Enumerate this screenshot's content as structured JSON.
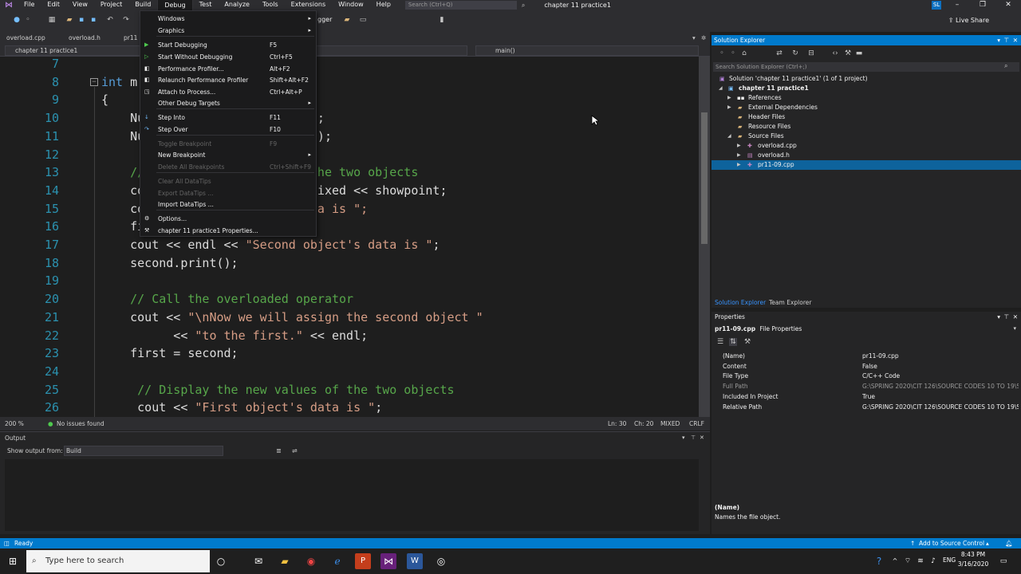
{
  "menubar": {
    "items": [
      "File",
      "Edit",
      "View",
      "Project",
      "Build",
      "Debug",
      "Test",
      "Analyze",
      "Tools",
      "Extensions",
      "Window",
      "Help"
    ],
    "search_placeholder": "Search (Ctrl+Q)",
    "window_title": "chapter 11 practice1",
    "user_initials": "SL"
  },
  "toolbar": {
    "live_share": "Live Share",
    "partial_label": "gger"
  },
  "doc_tabs": [
    "overload.cpp",
    "overload.h",
    "pr11"
  ],
  "nav": {
    "project": "chapter 11 practice1",
    "function": "main()"
  },
  "code_lines": [
    {
      "n": "7",
      "parts": []
    },
    {
      "n": "8",
      "parts": [
        {
          "t": "int",
          "c": "kw"
        },
        {
          "t": " m",
          "c": ""
        }
      ]
    },
    {
      "n": "9",
      "parts": [
        {
          "t": "{",
          "c": ""
        }
      ]
    },
    {
      "n": "10",
      "parts": [
        {
          "t": "    Nu",
          "c": ""
        },
        {
          "t": "                       );",
          "c": ""
        }
      ]
    },
    {
      "n": "11",
      "parts": [
        {
          "t": "    Nu",
          "c": ""
        },
        {
          "t": "                       5);",
          "c": ""
        }
      ]
    },
    {
      "n": "12",
      "parts": []
    },
    {
      "n": "13",
      "parts": [
        {
          "t": "    //",
          "c": "cmt"
        },
        {
          "t": "                       the two objects",
          "c": "cmt"
        }
      ]
    },
    {
      "n": "14",
      "parts": [
        {
          "t": "    co",
          "c": ""
        },
        {
          "t": "                     < fixed << showpoint;",
          "c": ""
        }
      ]
    },
    {
      "n": "15",
      "parts": [
        {
          "t": "    co",
          "c": ""
        },
        {
          "t": "                      ",
          "c": ""
        },
        {
          "t": "ata is \";",
          "c": "str"
        }
      ]
    },
    {
      "n": "16",
      "parts": [
        {
          "t": "    fi",
          "c": ""
        }
      ]
    },
    {
      "n": "17",
      "parts": [
        {
          "t": "    cout << endl << ",
          "c": ""
        },
        {
          "t": "\"Second object's data is \"",
          "c": "str"
        },
        {
          "t": ";",
          "c": ""
        }
      ]
    },
    {
      "n": "18",
      "parts": [
        {
          "t": "    second.print();",
          "c": ""
        }
      ]
    },
    {
      "n": "19",
      "parts": []
    },
    {
      "n": "20",
      "parts": [
        {
          "t": "    // Call the overloaded operator",
          "c": "cmt"
        }
      ]
    },
    {
      "n": "21",
      "parts": [
        {
          "t": "    cout << ",
          "c": ""
        },
        {
          "t": "\"\\nNow we will assign the second object \"",
          "c": "str"
        }
      ]
    },
    {
      "n": "22",
      "parts": [
        {
          "t": "          << ",
          "c": ""
        },
        {
          "t": "\"to the first.\"",
          "c": "str"
        },
        {
          "t": " << endl;",
          "c": ""
        }
      ]
    },
    {
      "n": "23",
      "parts": [
        {
          "t": "    first = second;",
          "c": ""
        }
      ]
    },
    {
      "n": "24",
      "parts": []
    },
    {
      "n": "25",
      "parts": [
        {
          "t": "     // Display the new values of the two objects",
          "c": "cmt"
        }
      ]
    },
    {
      "n": "26",
      "parts": [
        {
          "t": "     cout << ",
          "c": ""
        },
        {
          "t": "\"First object's data is \"",
          "c": "str"
        },
        {
          "t": ";",
          "c": ""
        }
      ]
    }
  ],
  "editor_status": {
    "zoom": "200 %",
    "issues": "No issues found",
    "ln": "Ln: 30",
    "ch": "Ch: 20",
    "mixed": "MIXED",
    "crlf": "CRLF"
  },
  "output": {
    "title": "Output",
    "show_from_label": "Show output from:",
    "source": "Build"
  },
  "solution_explorer": {
    "title": "Solution Explorer",
    "search_placeholder": "Search Solution Explorer (Ctrl+;)",
    "solution": "Solution 'chapter 11 practice1' (1 of 1 project)",
    "project": "chapter 11 practice1",
    "items": [
      "References",
      "External Dependencies",
      "Header Files",
      "Resource Files",
      "Source Files"
    ],
    "files": [
      "overload.cpp",
      "overload.h",
      "pr11-09.cpp"
    ],
    "tabs": [
      "Solution Explorer",
      "Team Explorer"
    ]
  },
  "properties": {
    "title": "Properties",
    "object_name": "pr11-09.cpp",
    "object_type": "File Properties",
    "rows": [
      {
        "name": "(Name)",
        "value": "pr11-09.cpp"
      },
      {
        "name": "Content",
        "value": "False"
      },
      {
        "name": "File Type",
        "value": "C/C++ Code"
      },
      {
        "name": "Full Path",
        "value": "G:\\SPRING 2020\\CIT 126\\SOURCE CODES 10 TO 19\\Sour"
      },
      {
        "name": "Included In Project",
        "value": "True"
      },
      {
        "name": "Relative Path",
        "value": "G:\\SPRING 2020\\CIT 126\\SOURCE CODES 10 TO 19\\Sour"
      }
    ],
    "desc_title": "(Name)",
    "desc": "Names the file object."
  },
  "statusbar": {
    "ready": "Ready",
    "source_control": "Add to Source Control"
  },
  "taskbar": {
    "search_placeholder": "Type here to search",
    "lang": "ENG",
    "time": "8:43 PM",
    "date": "3/16/2020"
  },
  "debug_menu": {
    "items": [
      {
        "label": "Windows",
        "shortcut": "",
        "submenu": true,
        "disabled": false,
        "icon": ""
      },
      {
        "label": "Graphics",
        "shortcut": "",
        "submenu": true,
        "disabled": false,
        "icon": ""
      },
      {
        "label": "Start Debugging",
        "shortcut": "F5",
        "submenu": false,
        "disabled": false,
        "icon": "play"
      },
      {
        "label": "Start Without Debugging",
        "shortcut": "Ctrl+F5",
        "submenu": false,
        "disabled": false,
        "icon": "play-outline"
      },
      {
        "label": "Performance Profiler...",
        "shortcut": "Alt+F2",
        "submenu": false,
        "disabled": false,
        "icon": "profiler"
      },
      {
        "label": "Relaunch Performance Profiler",
        "shortcut": "Shift+Alt+F2",
        "submenu": false,
        "disabled": false,
        "icon": "profiler"
      },
      {
        "label": "Attach to Process...",
        "shortcut": "Ctrl+Alt+P",
        "submenu": false,
        "disabled": false,
        "icon": "attach"
      },
      {
        "label": "Other Debug Targets",
        "shortcut": "",
        "submenu": true,
        "disabled": false,
        "icon": ""
      },
      {
        "label": "Step Into",
        "shortcut": "F11",
        "submenu": false,
        "disabled": false,
        "icon": "step-into"
      },
      {
        "label": "Step Over",
        "shortcut": "F10",
        "submenu": false,
        "disabled": false,
        "icon": "step-over"
      },
      {
        "label": "Toggle Breakpoint",
        "shortcut": "F9",
        "submenu": false,
        "disabled": true,
        "icon": ""
      },
      {
        "label": "New Breakpoint",
        "shortcut": "",
        "submenu": true,
        "disabled": false,
        "icon": ""
      },
      {
        "label": "Delete All Breakpoints",
        "shortcut": "Ctrl+Shift+F9",
        "submenu": false,
        "disabled": true,
        "icon": ""
      },
      {
        "label": "Clear All DataTips",
        "shortcut": "",
        "submenu": false,
        "disabled": true,
        "icon": ""
      },
      {
        "label": "Export DataTips ...",
        "shortcut": "",
        "submenu": false,
        "disabled": true,
        "icon": ""
      },
      {
        "label": "Import DataTips ...",
        "shortcut": "",
        "submenu": false,
        "disabled": false,
        "icon": ""
      },
      {
        "label": "Options...",
        "shortcut": "",
        "submenu": false,
        "disabled": false,
        "icon": "gear"
      },
      {
        "label": "chapter 11 practice1 Properties...",
        "shortcut": "",
        "submenu": false,
        "disabled": false,
        "icon": "wrench"
      }
    ]
  },
  "colors": {
    "accent": "#007acc",
    "menu_bg": "#1b1b1c",
    "editor_bg": "#1e1e1e",
    "selection": "#0e639c"
  }
}
